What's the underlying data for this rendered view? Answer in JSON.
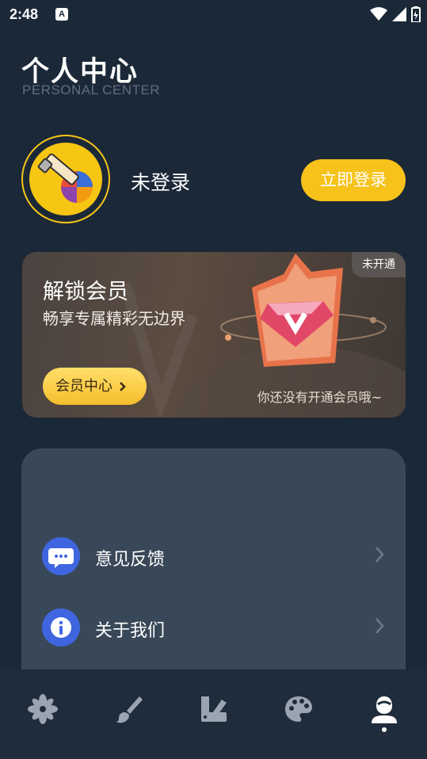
{
  "status": {
    "time": "2:48",
    "badge": "A"
  },
  "header": {
    "title_cn": "个人中心",
    "title_en": "PERSONAL CENTER"
  },
  "profile": {
    "username": "未登录",
    "login_label": "立即登录"
  },
  "vip": {
    "title": "解锁会员",
    "subtitle": "畅享专属精彩无边界",
    "badge": "未开通",
    "center_button": "会员中心",
    "note": "你还没有开通会员哦~"
  },
  "menu": {
    "items": [
      {
        "label": "意见反馈",
        "icon": "chat-bubble-icon"
      },
      {
        "label": "关于我们",
        "icon": "info-icon"
      }
    ]
  },
  "tabbar": {
    "items": [
      {
        "icon": "flower-icon"
      },
      {
        "icon": "brush-icon"
      },
      {
        "icon": "palette-swatch-icon"
      },
      {
        "icon": "palette-icon"
      },
      {
        "icon": "profile-icon",
        "active": true
      }
    ]
  },
  "colors": {
    "accent": "#f7c21a",
    "background": "#1b2838",
    "card": "#394858",
    "menu_icon": "#3f66e0"
  }
}
